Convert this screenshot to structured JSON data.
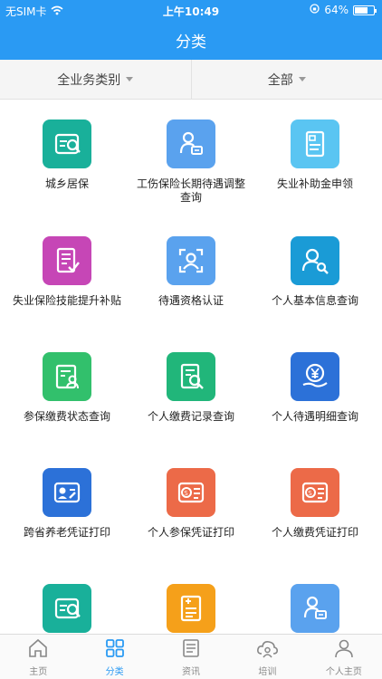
{
  "status": {
    "carrier": "无SIM卡",
    "time": "上午10:49",
    "battery": "64%"
  },
  "header": {
    "title": "分类"
  },
  "filters": {
    "category": "全业务类别",
    "scope": "全部"
  },
  "items": [
    {
      "label": "城乡居保",
      "icon": "id-card-search-icon",
      "color": "#19b09a"
    },
    {
      "label": "工伤保险长期待遇调整查询",
      "icon": "person-card-icon",
      "color": "#5aa2ee"
    },
    {
      "label": "失业补助金申领",
      "icon": "document-icon",
      "color": "#5ac5f2"
    },
    {
      "label": "失业保险技能提升补贴",
      "icon": "checklist-icon",
      "color": "#c646b6"
    },
    {
      "label": "待遇资格认证",
      "icon": "face-scan-icon",
      "color": "#5aa2ee"
    },
    {
      "label": "个人基本信息查询",
      "icon": "user-search-icon",
      "color": "#1a9bd6"
    },
    {
      "label": "参保缴费状态查询",
      "icon": "form-person-icon",
      "color": "#32c06c"
    },
    {
      "label": "个人缴费记录查询",
      "icon": "record-search-icon",
      "color": "#21b67a"
    },
    {
      "label": "个人待遇明细查询",
      "icon": "yuan-hand-icon",
      "color": "#2c71d8"
    },
    {
      "label": "跨省养老凭证打印",
      "icon": "id-card-print-icon",
      "color": "#2c71d8"
    },
    {
      "label": "个人参保凭证打印",
      "icon": "card-print-icon",
      "color": "#ec6a48"
    },
    {
      "label": "个人缴费凭证打印",
      "icon": "card-print-icon",
      "color": "#ec6a48"
    },
    {
      "label": "",
      "icon": "id-card-search-icon",
      "color": "#19b09a"
    },
    {
      "label": "",
      "icon": "doc-add-icon",
      "color": "#f5a01a"
    },
    {
      "label": "",
      "icon": "person-card-icon",
      "color": "#5aa2ee"
    }
  ],
  "tabs": [
    {
      "label": "主页",
      "icon": "home-icon",
      "active": false
    },
    {
      "label": "分类",
      "icon": "grid-icon",
      "active": true
    },
    {
      "label": "资讯",
      "icon": "news-icon",
      "active": false
    },
    {
      "label": "培训",
      "icon": "cloud-person-icon",
      "active": false
    },
    {
      "label": "个人主页",
      "icon": "person-icon",
      "active": false
    }
  ]
}
